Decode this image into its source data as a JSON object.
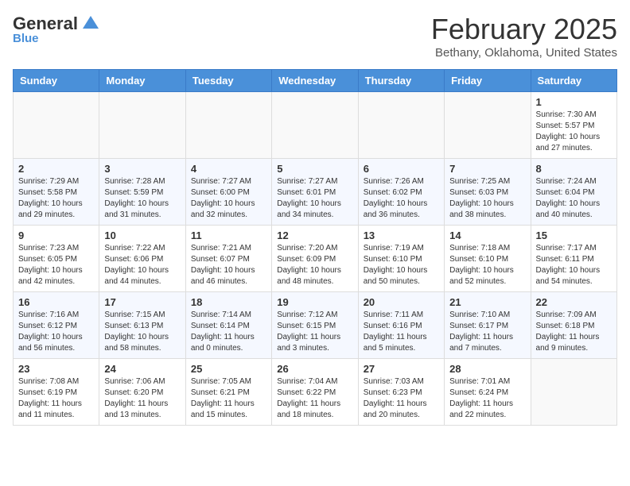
{
  "header": {
    "logo_line1_regular": "General",
    "logo_line1_blue": "",
    "logo_line2": "Blue",
    "month": "February 2025",
    "location": "Bethany, Oklahoma, United States"
  },
  "weekdays": [
    "Sunday",
    "Monday",
    "Tuesday",
    "Wednesday",
    "Thursday",
    "Friday",
    "Saturday"
  ],
  "weeks": [
    [
      {
        "day": "",
        "info": ""
      },
      {
        "day": "",
        "info": ""
      },
      {
        "day": "",
        "info": ""
      },
      {
        "day": "",
        "info": ""
      },
      {
        "day": "",
        "info": ""
      },
      {
        "day": "",
        "info": ""
      },
      {
        "day": "1",
        "info": "Sunrise: 7:30 AM\nSunset: 5:57 PM\nDaylight: 10 hours\nand 27 minutes."
      }
    ],
    [
      {
        "day": "2",
        "info": "Sunrise: 7:29 AM\nSunset: 5:58 PM\nDaylight: 10 hours\nand 29 minutes."
      },
      {
        "day": "3",
        "info": "Sunrise: 7:28 AM\nSunset: 5:59 PM\nDaylight: 10 hours\nand 31 minutes."
      },
      {
        "day": "4",
        "info": "Sunrise: 7:27 AM\nSunset: 6:00 PM\nDaylight: 10 hours\nand 32 minutes."
      },
      {
        "day": "5",
        "info": "Sunrise: 7:27 AM\nSunset: 6:01 PM\nDaylight: 10 hours\nand 34 minutes."
      },
      {
        "day": "6",
        "info": "Sunrise: 7:26 AM\nSunset: 6:02 PM\nDaylight: 10 hours\nand 36 minutes."
      },
      {
        "day": "7",
        "info": "Sunrise: 7:25 AM\nSunset: 6:03 PM\nDaylight: 10 hours\nand 38 minutes."
      },
      {
        "day": "8",
        "info": "Sunrise: 7:24 AM\nSunset: 6:04 PM\nDaylight: 10 hours\nand 40 minutes."
      }
    ],
    [
      {
        "day": "9",
        "info": "Sunrise: 7:23 AM\nSunset: 6:05 PM\nDaylight: 10 hours\nand 42 minutes."
      },
      {
        "day": "10",
        "info": "Sunrise: 7:22 AM\nSunset: 6:06 PM\nDaylight: 10 hours\nand 44 minutes."
      },
      {
        "day": "11",
        "info": "Sunrise: 7:21 AM\nSunset: 6:07 PM\nDaylight: 10 hours\nand 46 minutes."
      },
      {
        "day": "12",
        "info": "Sunrise: 7:20 AM\nSunset: 6:09 PM\nDaylight: 10 hours\nand 48 minutes."
      },
      {
        "day": "13",
        "info": "Sunrise: 7:19 AM\nSunset: 6:10 PM\nDaylight: 10 hours\nand 50 minutes."
      },
      {
        "day": "14",
        "info": "Sunrise: 7:18 AM\nSunset: 6:10 PM\nDaylight: 10 hours\nand 52 minutes."
      },
      {
        "day": "15",
        "info": "Sunrise: 7:17 AM\nSunset: 6:11 PM\nDaylight: 10 hours\nand 54 minutes."
      }
    ],
    [
      {
        "day": "16",
        "info": "Sunrise: 7:16 AM\nSunset: 6:12 PM\nDaylight: 10 hours\nand 56 minutes."
      },
      {
        "day": "17",
        "info": "Sunrise: 7:15 AM\nSunset: 6:13 PM\nDaylight: 10 hours\nand 58 minutes."
      },
      {
        "day": "18",
        "info": "Sunrise: 7:14 AM\nSunset: 6:14 PM\nDaylight: 11 hours\nand 0 minutes."
      },
      {
        "day": "19",
        "info": "Sunrise: 7:12 AM\nSunset: 6:15 PM\nDaylight: 11 hours\nand 3 minutes."
      },
      {
        "day": "20",
        "info": "Sunrise: 7:11 AM\nSunset: 6:16 PM\nDaylight: 11 hours\nand 5 minutes."
      },
      {
        "day": "21",
        "info": "Sunrise: 7:10 AM\nSunset: 6:17 PM\nDaylight: 11 hours\nand 7 minutes."
      },
      {
        "day": "22",
        "info": "Sunrise: 7:09 AM\nSunset: 6:18 PM\nDaylight: 11 hours\nand 9 minutes."
      }
    ],
    [
      {
        "day": "23",
        "info": "Sunrise: 7:08 AM\nSunset: 6:19 PM\nDaylight: 11 hours\nand 11 minutes."
      },
      {
        "day": "24",
        "info": "Sunrise: 7:06 AM\nSunset: 6:20 PM\nDaylight: 11 hours\nand 13 minutes."
      },
      {
        "day": "25",
        "info": "Sunrise: 7:05 AM\nSunset: 6:21 PM\nDaylight: 11 hours\nand 15 minutes."
      },
      {
        "day": "26",
        "info": "Sunrise: 7:04 AM\nSunset: 6:22 PM\nDaylight: 11 hours\nand 18 minutes."
      },
      {
        "day": "27",
        "info": "Sunrise: 7:03 AM\nSunset: 6:23 PM\nDaylight: 11 hours\nand 20 minutes."
      },
      {
        "day": "28",
        "info": "Sunrise: 7:01 AM\nSunset: 6:24 PM\nDaylight: 11 hours\nand 22 minutes."
      },
      {
        "day": "",
        "info": ""
      }
    ]
  ]
}
